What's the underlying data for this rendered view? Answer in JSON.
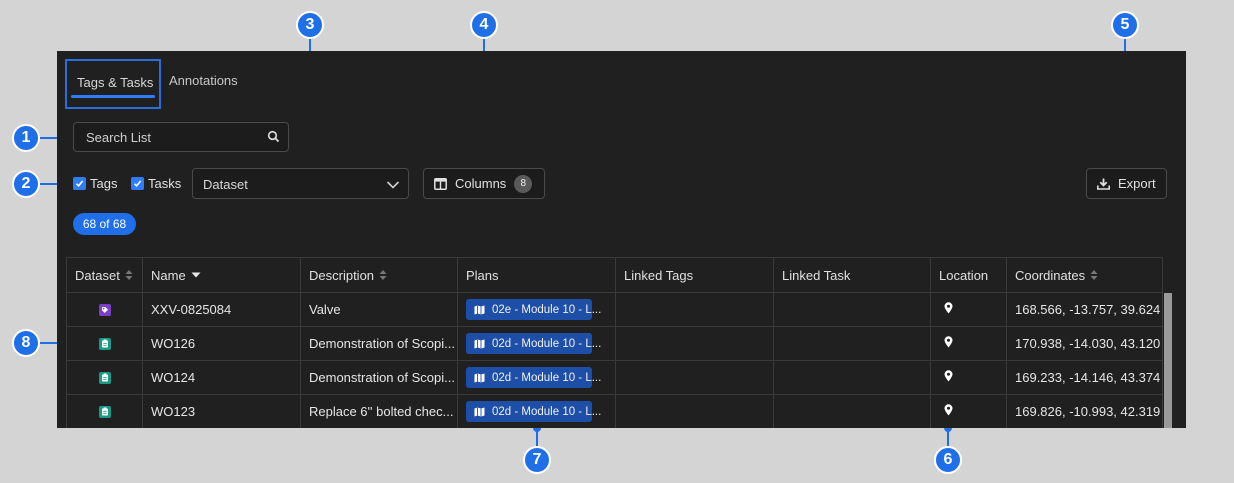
{
  "tabs": [
    {
      "label": "Tags & Tasks",
      "active": true
    },
    {
      "label": "Annotations",
      "active": false
    }
  ],
  "search": {
    "placeholder": "Search List",
    "icon": "search-icon"
  },
  "filters": {
    "tags_label": "Tags",
    "tags_checked": true,
    "tasks_label": "Tasks",
    "tasks_checked": true
  },
  "dataset_select": {
    "value": "Dataset"
  },
  "columns_button": {
    "label": "Columns",
    "count": "8"
  },
  "export_button": {
    "label": "Export"
  },
  "result_count": "68 of 68",
  "table": {
    "headers": [
      "Dataset",
      "Name",
      "Description",
      "Plans",
      "Linked Tags",
      "Linked Task",
      "Location",
      "Coordinates"
    ],
    "rows": [
      {
        "dataset_icon": "tag-icon",
        "dataset_color": "#7b3fc8",
        "name": "XXV-0825084",
        "description": "Valve",
        "plan": "02e - Module 10 - L...",
        "linked_tags": "",
        "linked_task": "",
        "coordinates": "168.566, -13.757, 39.624"
      },
      {
        "dataset_icon": "clipboard-icon",
        "dataset_color": "#1a9a86",
        "name": "WO126",
        "description": "Demonstration of Scopi...",
        "plan": "02d - Module 10 - L...",
        "linked_tags": "",
        "linked_task": "",
        "coordinates": "170.938, -14.030, 43.120"
      },
      {
        "dataset_icon": "clipboard-icon",
        "dataset_color": "#1a9a86",
        "name": "WO124",
        "description": "Demonstration of Scopi...",
        "plan": "02d - Module 10 - L...",
        "linked_tags": "",
        "linked_task": "",
        "coordinates": "169.233, -14.146, 43.374"
      },
      {
        "dataset_icon": "clipboard-icon",
        "dataset_color": "#1a9a86",
        "name": "WO123",
        "description": "Replace 6'' bolted chec...",
        "plan": "02d - Module 10 - L...",
        "linked_tags": "",
        "linked_task": "",
        "coordinates": "169.826, -10.993, 42.319"
      }
    ]
  },
  "callouts": [
    "1",
    "2",
    "3",
    "4",
    "5",
    "6",
    "7",
    "8"
  ],
  "colors": {
    "accent": "#1f6fe8",
    "panel_bg": "#202020",
    "page_bg": "#d4d4d4"
  }
}
